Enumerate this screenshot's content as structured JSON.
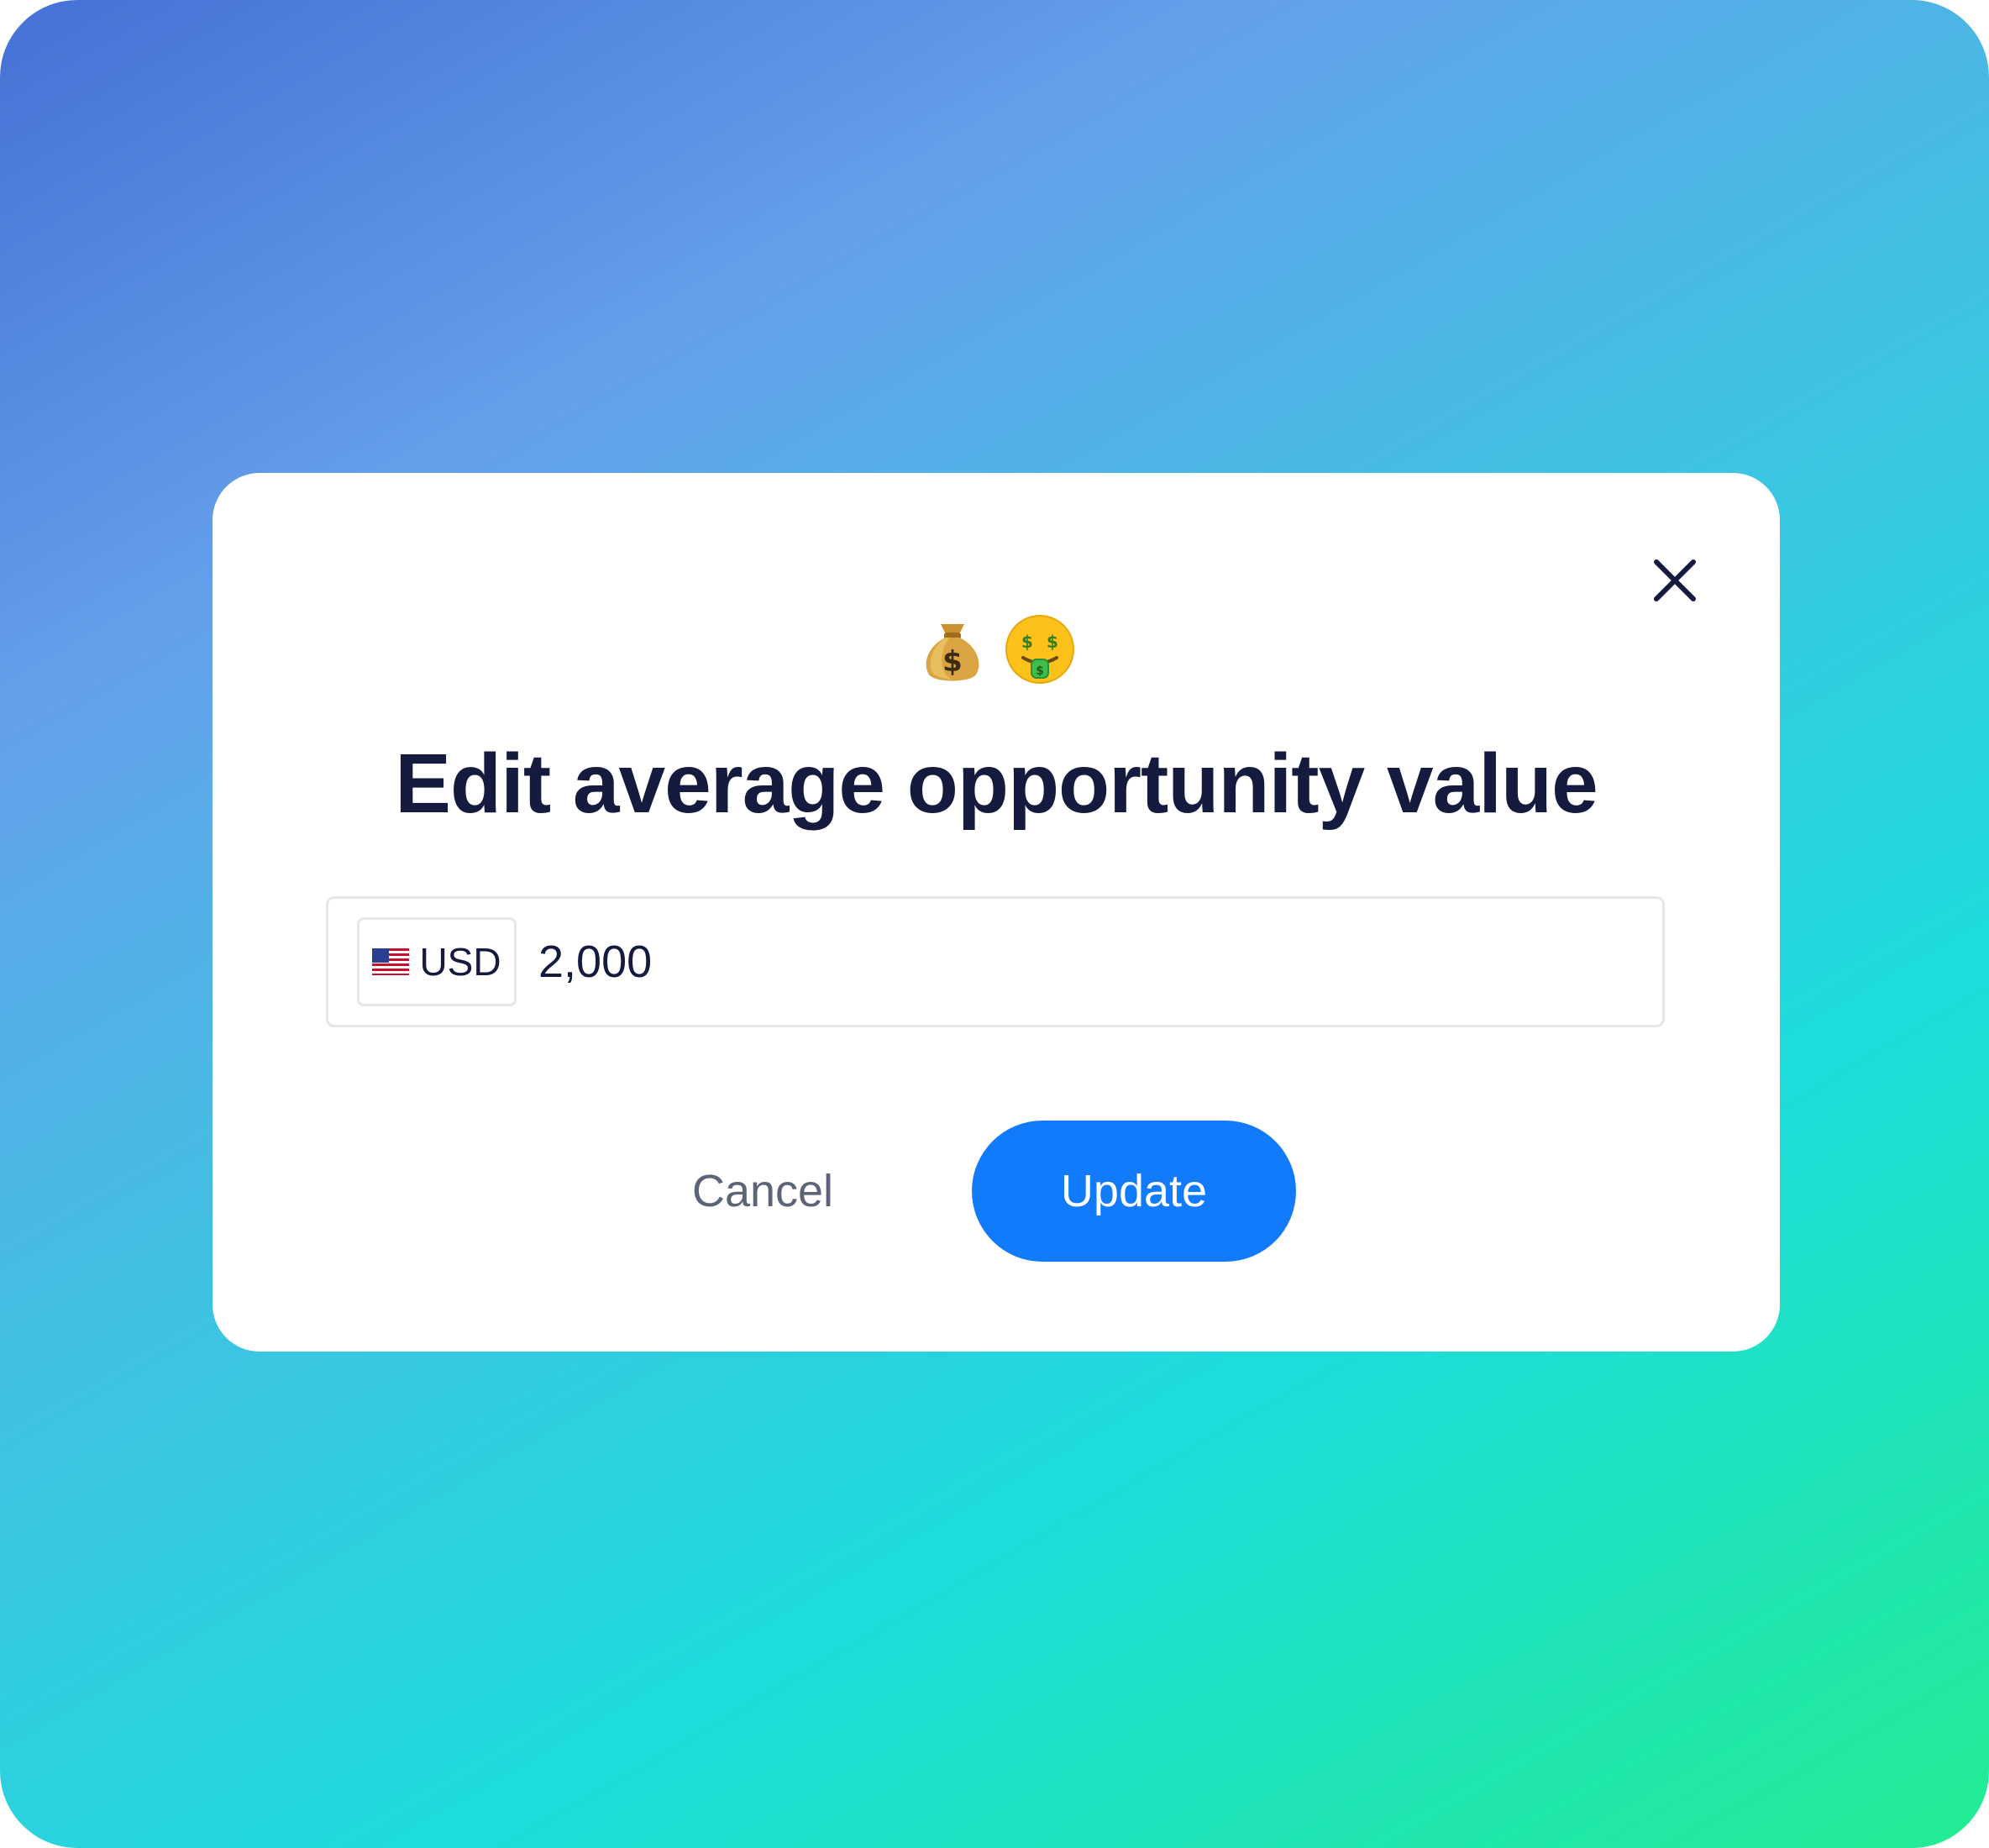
{
  "modal": {
    "emojis": [
      "money-bag-icon",
      "money-mouth-face-icon"
    ],
    "title": "Edit average opportunity value",
    "currency": {
      "flag": "us-flag-icon",
      "code": "USD"
    },
    "amount": {
      "value": "2,000"
    },
    "cancel_label": "Cancel",
    "update_label": "Update"
  },
  "colors": {
    "primary": "#127bfc",
    "title": "#151b3f",
    "muted": "#5c6478",
    "border": "#e4e6ea",
    "gradient_start": "#4670d6",
    "gradient_end": "#22ec92"
  }
}
